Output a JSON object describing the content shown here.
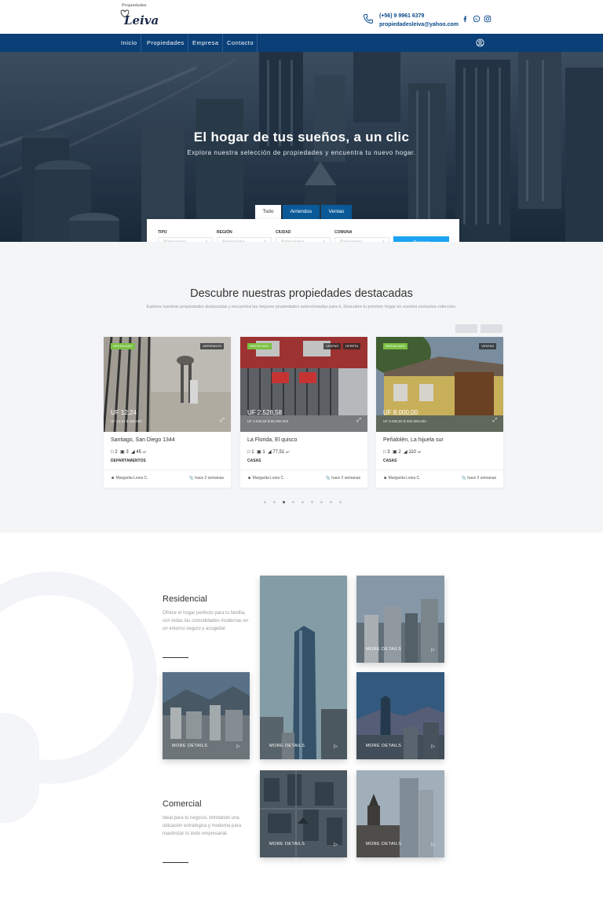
{
  "header": {
    "logo_small": "Propiedades",
    "logo_big": "Leiva",
    "phone": "(+56) 9 9961 6379",
    "email": "propiedadesleiva@yahoo.com",
    "social_icons": [
      "facebook-icon",
      "whatsapp-icon",
      "instagram-icon"
    ]
  },
  "nav": {
    "items": [
      "Inicio",
      "Propiedades",
      "Empresa",
      "Contacto"
    ],
    "user_icon": "user-circle-icon"
  },
  "hero": {
    "title": "El hogar de tus sueños, a un clic",
    "subtitle": "Explora nuestra selección de propiedades y encuentra tu nuevo hogar."
  },
  "search": {
    "tabs": [
      "Todo",
      "Arriendos",
      "Ventas"
    ],
    "active_tab": "Todo",
    "fields": [
      {
        "label": "TIPO",
        "value": "Selecciona"
      },
      {
        "label": "REGIÓN",
        "value": "Selecciona"
      },
      {
        "label": "CIUDAD",
        "value": "Selecciona"
      },
      {
        "label": "COMUNA",
        "value": "Selecciona"
      }
    ],
    "button": "Buscar"
  },
  "featured": {
    "title": "Descubre nuestras propiedades destacadas",
    "subtitle": "Explora nuestras propiedades destacadas y encuentra las mejores propiedades seleccionadas para ti. Descubre tu próximo hogar en nuestra exclusiva colección.",
    "prev_label": "Anterior",
    "next_label": "Siguiente",
    "cards": [
      {
        "badge": "DESTACADO",
        "tags": [
          "ARRIENDOS"
        ],
        "price": "UF 12,24",
        "price_sub": "UF 12,24 $ 460.000",
        "address": "Santiago, San Diego 1344",
        "beds": "2",
        "baths": "3",
        "area": "45",
        "area_unit": "m²",
        "type": "DEPARTAMENTOS",
        "agent": "Margarita Leiva C.",
        "since": "hace 2 semanas"
      },
      {
        "badge": "DESTACADO",
        "tags": [
          "VENTAS",
          "OFERTA"
        ],
        "price": "UF 2.528,58",
        "price_sub": "UF 2.528,58 $ 95.000.000",
        "address": "La Florida, El quisco",
        "beds": "1",
        "baths": "1",
        "area": "77,51",
        "area_unit": "m²",
        "type": "CASAS",
        "agent": "Margarita Leiva C.",
        "since": "hace 2 semanas"
      },
      {
        "badge": "DESTACADO",
        "tags": [
          "VENTAS"
        ],
        "price": "UF 8.000,00",
        "price_sub": "UF 8.000,00 $ 300.000.000",
        "address": "Peñalolén, La hijuela sur",
        "beds": "3",
        "baths": "2",
        "area": "110",
        "area_unit": "m²",
        "type": "CASAS",
        "agent": "Margarita Leiva C.",
        "since": "hace 2 semanas"
      }
    ],
    "pagination": {
      "total": 9,
      "active_index": 2
    }
  },
  "categories": {
    "residencial": {
      "title": "Residencial",
      "desc": "Ofrece el hogar perfecto para tu familia, con todas las comodidades modernas en un entorno seguro y acogedor."
    },
    "comercial": {
      "title": "Comercial",
      "desc": "Ideal para tu negocio, brindando una ubicación estratégica y moderna para maximizar tu éxito empresarial."
    },
    "tile_label": "MORE DETAILS"
  },
  "colors": {
    "nav": "#0a3f78",
    "accent": "#1aa3f2",
    "badge_green": "#7ac142"
  }
}
